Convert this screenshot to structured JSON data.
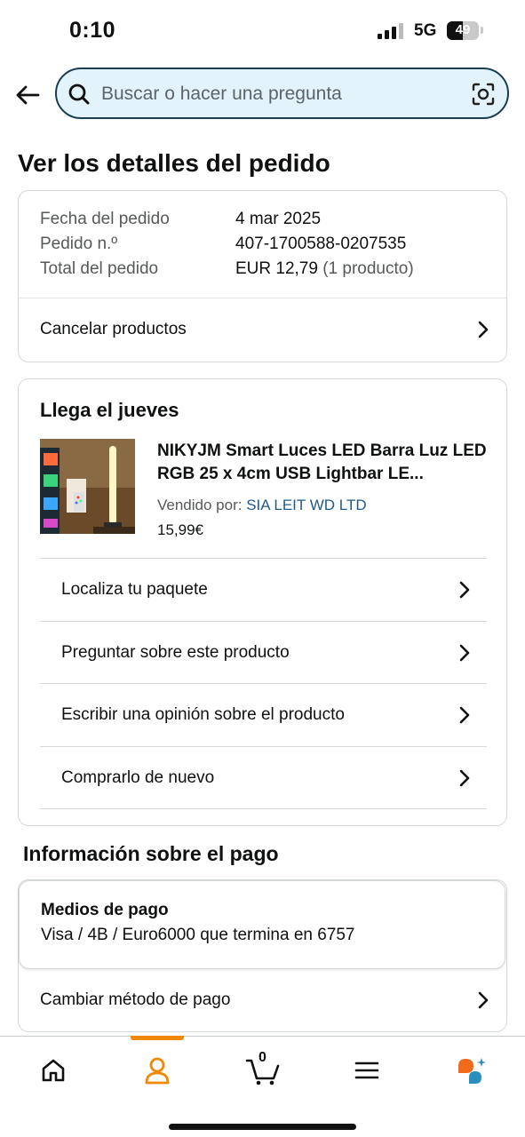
{
  "status_bar": {
    "time": "0:10",
    "network": "5G",
    "battery_level": "49"
  },
  "header": {
    "search_placeholder": "Buscar o hacer una pregunta"
  },
  "page_title": "Ver los detalles del pedido",
  "order_summary": {
    "date_label": "Fecha del pedido",
    "date_value": "4 mar 2025",
    "number_label": "Pedido n.º",
    "number_value": "407-1700588-0207535",
    "total_label": "Total del pedido",
    "total_value": "EUR 12,79",
    "total_count": "(1 producto)",
    "cancel_label": "Cancelar productos"
  },
  "shipment": {
    "arrival": "Llega el jueves",
    "product_title": "NIKYJM Smart Luces LED Barra Luz LED RGB 25 x 4cm USB Lightbar LE...",
    "sold_by_label": "Vendido por:",
    "seller": "SIA LEIT WD LTD",
    "price": "15,99€",
    "actions": [
      "Localiza tu paquete",
      "Preguntar sobre este producto",
      "Escribir una opinión sobre el producto",
      "Comprarlo de nuevo"
    ]
  },
  "payment": {
    "section_title": "Información sobre el pago",
    "methods_label": "Medios de pago",
    "methods_value": "Visa / 4B / Euro6000  que termina en 6757",
    "change_label": "Cambiar método de pago"
  },
  "bottom_nav": {
    "cart_count": "0",
    "active_tab": "account",
    "accent_color": "#f08804",
    "items": [
      "home-icon",
      "account-icon",
      "cart-icon",
      "menu-icon",
      "rufus-icon"
    ]
  }
}
